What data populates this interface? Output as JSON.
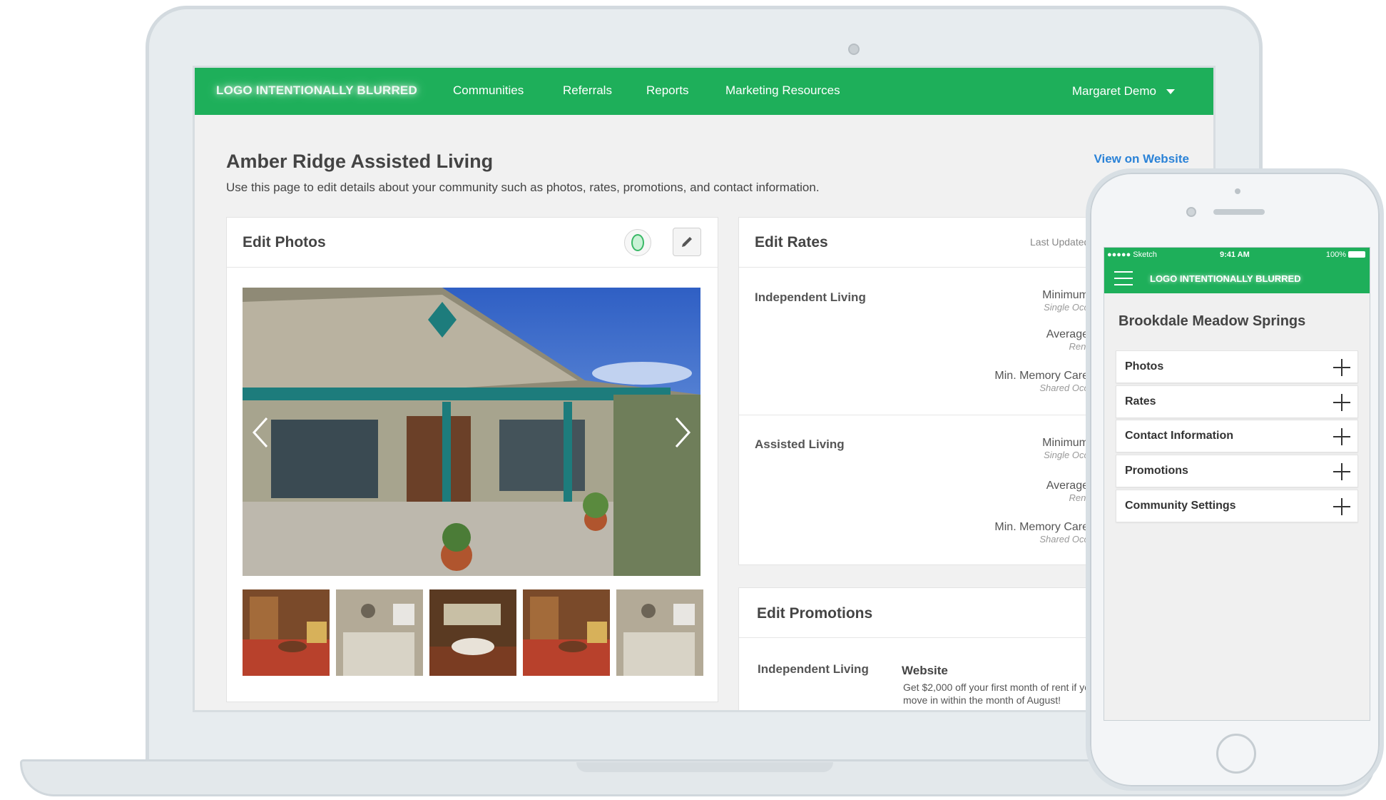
{
  "nav": {
    "logo": "LOGO INTENTIONALLY BLURRED",
    "links": [
      "Communities",
      "Referrals",
      "Reports",
      "Marketing Resources"
    ],
    "user": "Margaret Demo"
  },
  "page": {
    "title": "Amber Ridge Assisted Living",
    "subtitle": "Use this page to edit details about your community such as photos, rates, promotions, and contact information.",
    "view_website": "View on Website"
  },
  "photos": {
    "title": "Edit Photos",
    "thumbnail_count": 5
  },
  "rates": {
    "title": "Edit Rates",
    "last_updated": "Last Updated",
    "sections": [
      {
        "label": "Independent Living",
        "rows": [
          {
            "name": "Minimum",
            "note": "Single Occ"
          },
          {
            "name": "Average",
            "note": "Rent"
          },
          {
            "name": "Min. Memory Care",
            "note": "Shared Occ"
          }
        ]
      },
      {
        "label": "Assisted Living",
        "rows": [
          {
            "name": "Minimum",
            "note": "Single Occ"
          },
          {
            "name": "Average",
            "note": "Rent"
          },
          {
            "name": "Min. Memory Care",
            "note": "Shared Occ"
          }
        ]
      }
    ]
  },
  "promotions": {
    "title": "Edit Promotions",
    "label": "Independent Living",
    "source": "Website",
    "text": "Get $2,000 off your first month of rent if you move in within the month of August!"
  },
  "phone": {
    "status": {
      "carrier": "●●●●● Sketch",
      "time": "9:41 AM",
      "battery": "100%"
    },
    "logo": "LOGO INTENTIONALLY BLURRED",
    "title": "Brookdale Meadow Springs",
    "items": [
      "Photos",
      "Rates",
      "Contact Information",
      "Promotions",
      "Community Settings"
    ]
  },
  "colors": {
    "brand_green": "#1eaf5a",
    "link_blue": "#2a82d7"
  }
}
